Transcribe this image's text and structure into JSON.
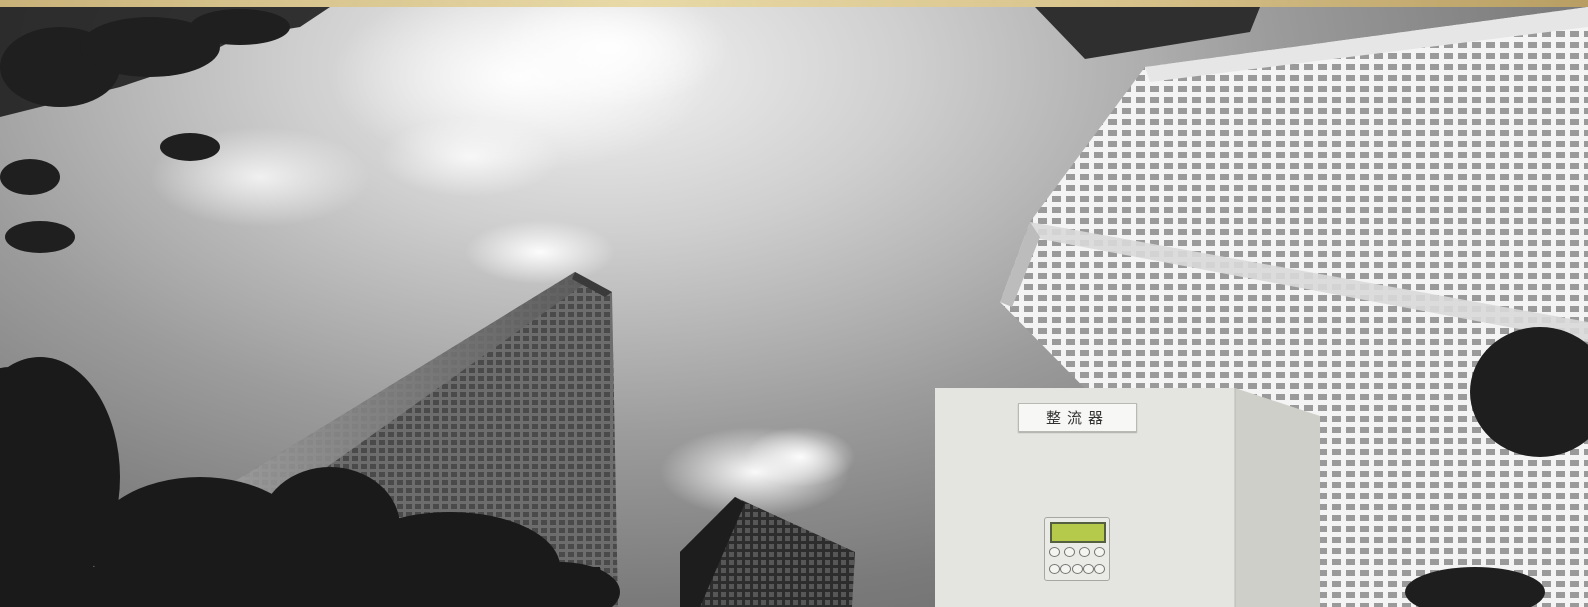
{
  "scene": {
    "description_colors": {
      "accent_strip": "#d8c38c",
      "device_body": "#e4e4e0",
      "lcd_screen": "#b5c94a"
    },
    "device": {
      "nameplate_text": "整流器"
    }
  }
}
